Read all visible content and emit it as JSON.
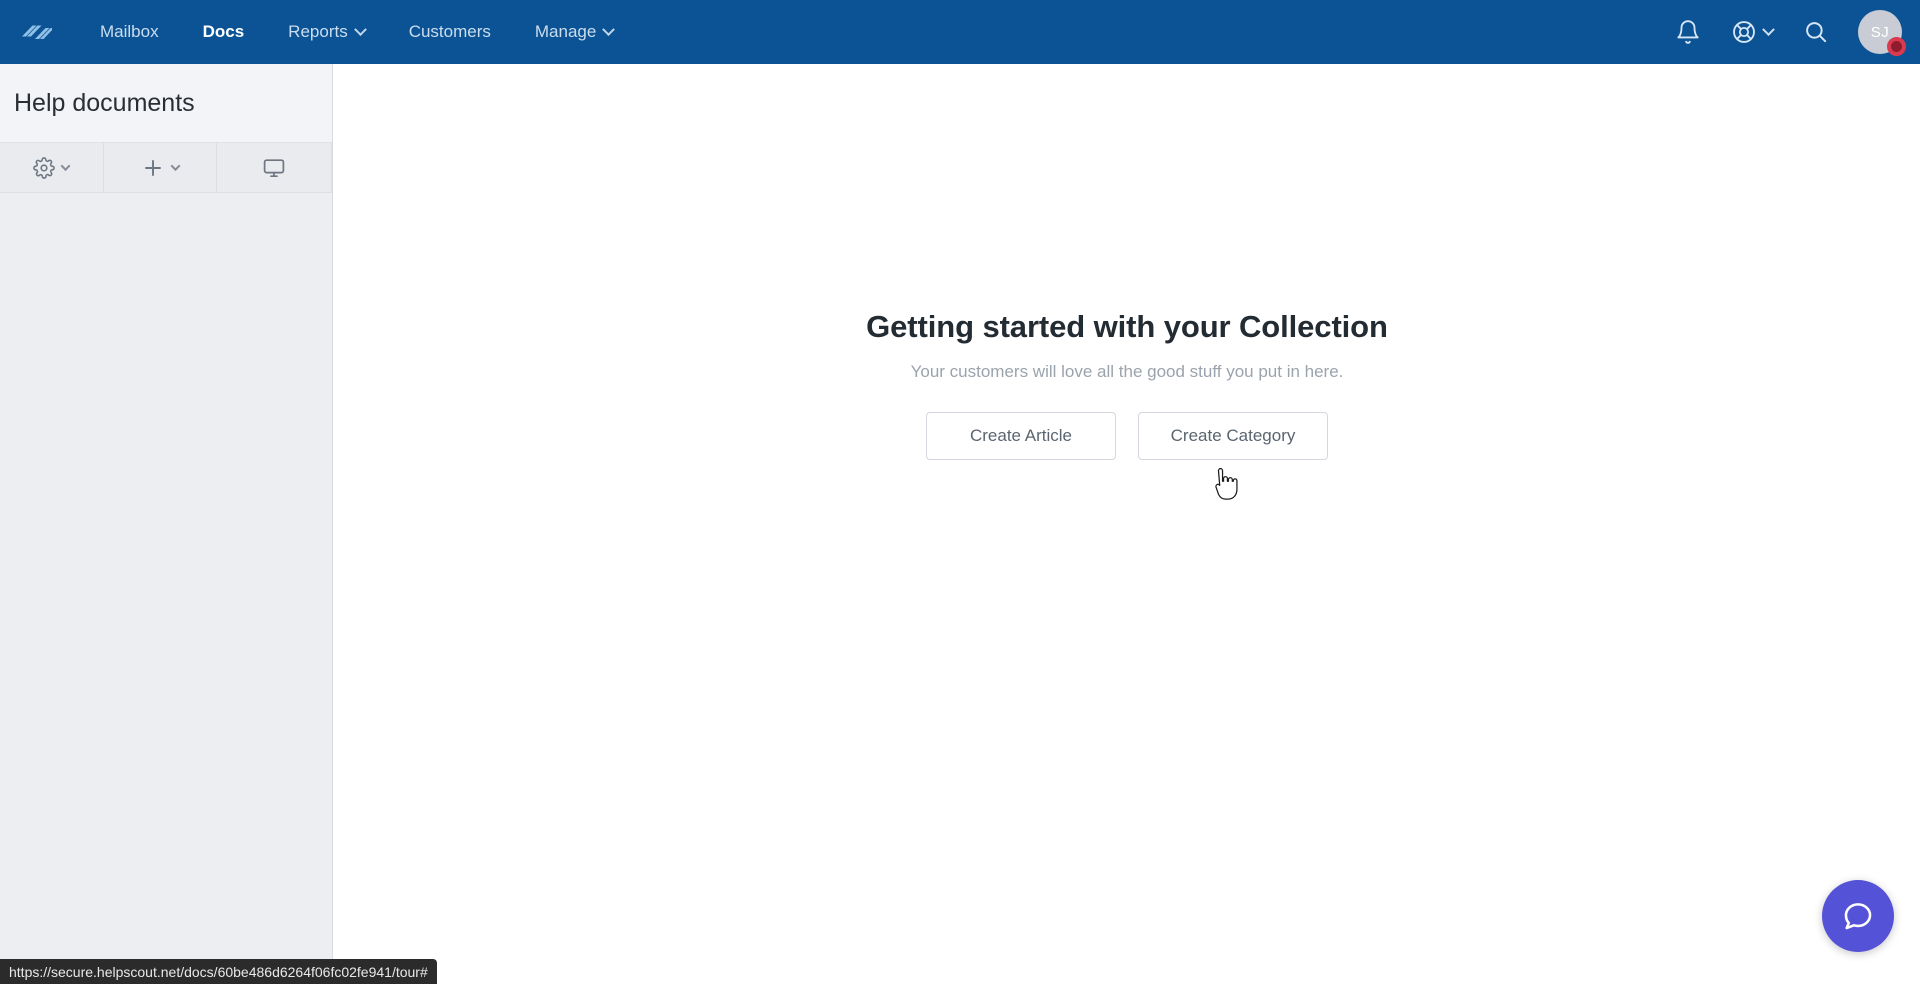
{
  "colors": {
    "nav_blue": "#0b5394",
    "beacon_purple": "#5452d6",
    "sidebar_gray": "#eceef2",
    "badge_red": "#d93a4f"
  },
  "topnav": {
    "logo_name": "helpscout-logo",
    "items": [
      {
        "label": "Mailbox",
        "active": false,
        "has_chevron": false
      },
      {
        "label": "Docs",
        "active": true,
        "has_chevron": false
      },
      {
        "label": "Reports",
        "active": false,
        "has_chevron": true
      },
      {
        "label": "Customers",
        "active": false,
        "has_chevron": false
      },
      {
        "label": "Manage",
        "active": false,
        "has_chevron": true
      }
    ],
    "icons": {
      "notifications": "bell-icon",
      "help": "lifebuoy-icon",
      "search": "search-icon"
    },
    "avatar": {
      "initials": "SJ",
      "status": "away"
    }
  },
  "sidebar": {
    "title": "Help documents",
    "toolbar": [
      {
        "name": "settings",
        "icon": "gear-icon",
        "has_chevron": true
      },
      {
        "name": "add",
        "icon": "plus-icon",
        "has_chevron": true
      },
      {
        "name": "preview",
        "icon": "monitor-icon",
        "has_chevron": false
      }
    ],
    "items": []
  },
  "main": {
    "empty_state": {
      "title": "Getting started with your Collection",
      "subtitle": "Your customers will love all the good stuff you put in here.",
      "buttons": [
        {
          "label": "Create Article"
        },
        {
          "label": "Create Category"
        }
      ]
    }
  },
  "beacon": {
    "icon": "chat-bubble-icon"
  },
  "statusbar": {
    "url": "https://secure.helpscout.net/docs/60be486d6264f06fc02fe941/tour#"
  }
}
